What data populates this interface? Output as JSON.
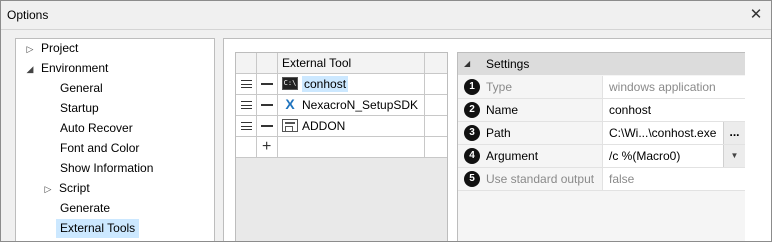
{
  "window": {
    "title": "Options",
    "close_glyph": "✕"
  },
  "tree": {
    "items": [
      {
        "label": "Project",
        "arrow": "▷"
      },
      {
        "label": "Environment",
        "arrow": "◢"
      },
      {
        "label": "General"
      },
      {
        "label": "Startup"
      },
      {
        "label": "Auto Recover"
      },
      {
        "label": "Font and Color"
      },
      {
        "label": "Show Information"
      },
      {
        "label": "Script",
        "arrow": "▷"
      },
      {
        "label": "Generate"
      },
      {
        "label": "External Tools"
      }
    ]
  },
  "grid": {
    "header": "External Tool",
    "rows": [
      {
        "name": "conhost",
        "icon": "console-icon",
        "icon_glyph": "C:\\",
        "selected": true
      },
      {
        "name": "NexacroN_SetupSDK",
        "icon": "nexacro-x-icon",
        "icon_glyph": "X"
      },
      {
        "name": "ADDON",
        "icon": "app-window-icon"
      }
    ],
    "add_glyph": "+"
  },
  "settings": {
    "header": "Settings",
    "props": [
      {
        "badge": "1",
        "name": "Type",
        "value": "windows application",
        "disabled": true
      },
      {
        "badge": "2",
        "name": "Name",
        "value": "conhost"
      },
      {
        "badge": "3",
        "name": "Path",
        "value": "C:\\Wi...\\conhost.exe",
        "button": "..."
      },
      {
        "badge": "4",
        "name": "Argument",
        "value": "/c %(Macro0)",
        "dropdown": true
      },
      {
        "badge": "5",
        "name": "Use standard output",
        "value": "false",
        "disabled": true
      }
    ]
  },
  "colors": {
    "selection": "#cce8ff",
    "badge": "#111111"
  }
}
